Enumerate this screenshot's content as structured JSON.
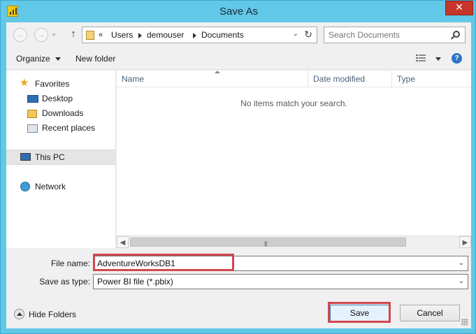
{
  "window": {
    "title": "Save As",
    "close_glyph": "✕"
  },
  "address_bar": {
    "overflow": "«",
    "path": [
      "Users",
      "demouser",
      "Documents"
    ]
  },
  "search": {
    "placeholder": "Search Documents"
  },
  "toolbar": {
    "organize_label": "Organize",
    "new_folder_label": "New folder"
  },
  "nav_pane": {
    "favorites": {
      "label": "Favorites",
      "items": [
        "Desktop",
        "Downloads",
        "Recent places"
      ]
    },
    "this_pc": "This PC",
    "network": "Network"
  },
  "file_list": {
    "columns": [
      "Name",
      "Date modified",
      "Type"
    ],
    "empty_message": "No items match your search."
  },
  "form": {
    "file_name_label": "File name:",
    "file_name_value": "AdventureWorksDB1",
    "save_type_label": "Save as type:",
    "save_type_value": "Power BI file (*.pbix)"
  },
  "footer": {
    "hide_folders_label": "Hide Folders",
    "save_label": "Save",
    "cancel_label": "Cancel"
  },
  "colors": {
    "window_frame": "#62c8e8",
    "close_button": "#c7352b",
    "highlight_box": "#d1474e",
    "app_icon": "#f2c811"
  },
  "icons": [
    "back-arrow-icon",
    "forward-arrow-icon",
    "up-arrow-icon",
    "folder-icon",
    "refresh-icon",
    "search-icon",
    "star-icon",
    "desktop-icon",
    "downloads-icon",
    "recent-places-icon",
    "computer-icon",
    "network-icon",
    "view-options-icon",
    "help-icon"
  ]
}
